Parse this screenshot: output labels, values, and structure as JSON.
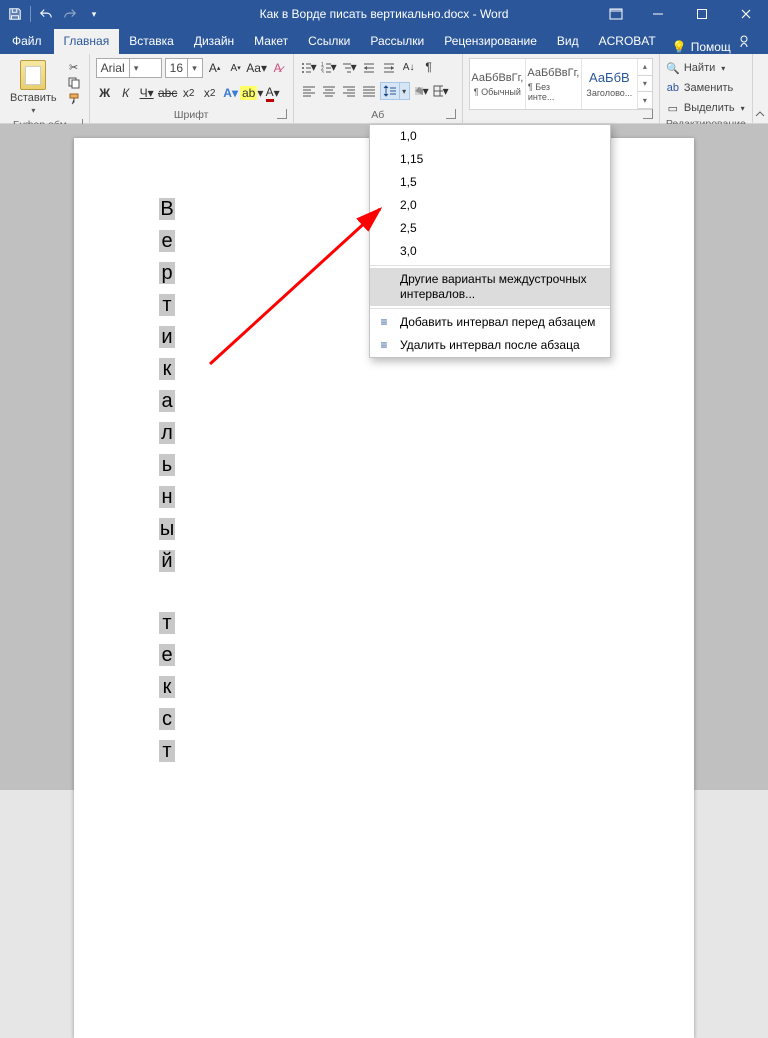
{
  "titlebar": {
    "title": "Как в Ворде писать вертикально.docx - Word"
  },
  "tabs": {
    "file": "Файл",
    "items": [
      "Главная",
      "Вставка",
      "Дизайн",
      "Макет",
      "Ссылки",
      "Рассылки",
      "Рецензирование",
      "Вид",
      "ACROBAT"
    ],
    "activeIndex": 0,
    "help": "Помощ"
  },
  "ribbon": {
    "clipboard": {
      "paste": "Вставить",
      "label": "Буфер обм..."
    },
    "font": {
      "name": "Arial",
      "size": "16",
      "label": "Шрифт"
    },
    "paragraph": {
      "label": "Аб"
    },
    "styles": {
      "items": [
        {
          "preview": "АаБбВвГг,",
          "name": "¶ Обычный"
        },
        {
          "preview": "АаБбВвГг,",
          "name": "¶ Без инте..."
        },
        {
          "preview": "АаБбВ",
          "name": "Заголово...",
          "blue": true
        }
      ],
      "label": ""
    },
    "editing": {
      "find": "Найти",
      "replace": "Заменить",
      "select": "Выделить",
      "label": "Редактирование"
    }
  },
  "dropdown": {
    "spacing": [
      "1,0",
      "1,15",
      "1,5",
      "2,0",
      "2,5",
      "3,0"
    ],
    "moreOptions": "Другие варианты междустрочных интервалов...",
    "addBefore": "Добавить интервал перед абзацем",
    "removeAfter": "Удалить интервал после абзаца"
  },
  "document": {
    "word1": [
      "В",
      "е",
      "р",
      "т",
      "и",
      "к",
      "а",
      "л",
      "ь",
      "н",
      "ы",
      "й"
    ],
    "word2": [
      "т",
      "е",
      "к",
      "с",
      "т"
    ]
  }
}
